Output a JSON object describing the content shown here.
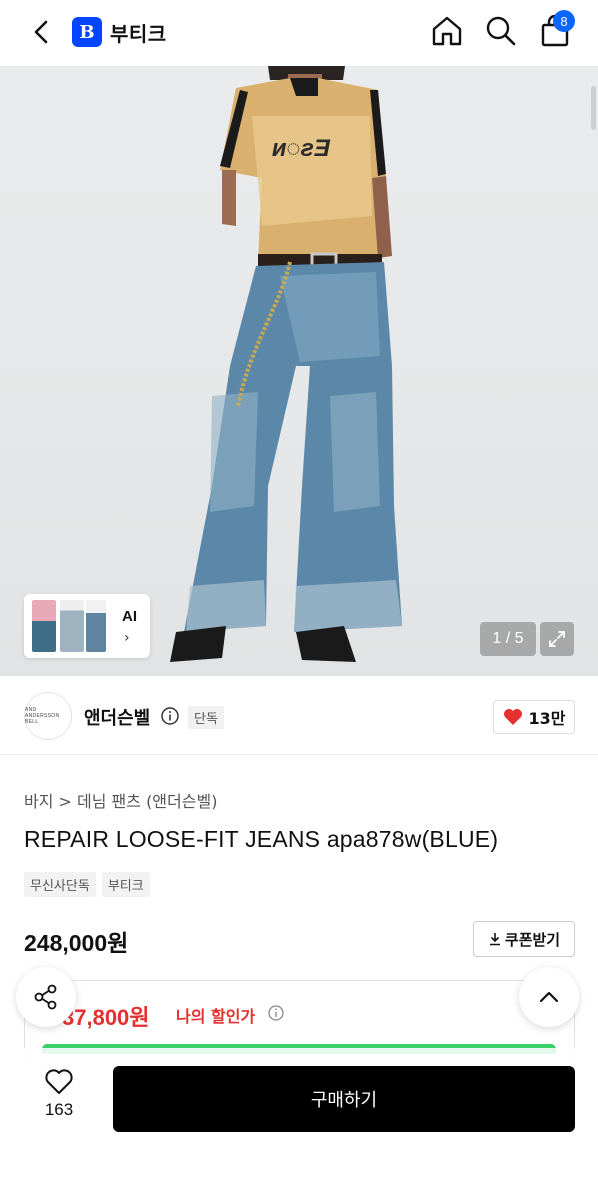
{
  "header": {
    "brand_badge": "B",
    "brand_name": "부티크",
    "cart_count": "8"
  },
  "gallery": {
    "ai_label": "AI",
    "counter": "1 / 5"
  },
  "brand": {
    "logo_text": "AND ANDERSSON BELL",
    "name": "앤더슨벨",
    "exclusive_tag": "단독",
    "likes": "13만"
  },
  "product": {
    "breadcrumb": "바지 > 데님 팬츠 (앤더슨벨)",
    "title": "REPAIR LOOSE-FIT JEANS apa878w(BLUE)",
    "tags": [
      "무신사단독",
      "부티크"
    ],
    "price": "248,000원",
    "coupon_label": "쿠폰받기",
    "discount_price": "37,800원",
    "discount_label": "나의 할인가"
  },
  "bottom": {
    "wish_count": "163",
    "buy_label": "구매하기"
  },
  "colors": {
    "accent": "#0046ff",
    "sale": "#e4302f",
    "like": "#e4302f",
    "green": "#3ad06a"
  }
}
